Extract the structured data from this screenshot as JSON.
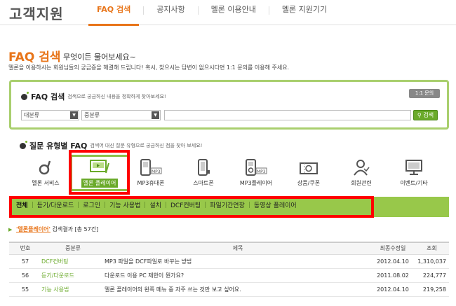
{
  "header": {
    "logo": "고객지원",
    "tabs": [
      {
        "label": "FAQ 검색"
      },
      {
        "label": "공지사항"
      },
      {
        "label": "멜론 이용안내"
      },
      {
        "label": "멜론 지원기기"
      }
    ]
  },
  "page": {
    "title": "FAQ 검색",
    "subtitle": "무엇이든 물어보세요~",
    "description": "멜론을 이용하시는 회원님들의 궁금증을 해결해 드립니다! 혹시, 찾으시는 답변이 없으시다면 1:1 문의를 이용해 주세요."
  },
  "search": {
    "title": "FAQ 검색",
    "hint": "검색으로 궁금하신 내용을 정확하게 찾아보세요!",
    "one_to_one": "1:1 문의",
    "category1": "대분류",
    "category2": "중분류",
    "query": "",
    "button": "검색"
  },
  "question_types": {
    "title": "질문 유형별 FAQ",
    "hint": "검색어 대신 질문 유형으로 궁금하신 점을 찾아 보세요!",
    "categories": [
      {
        "label": "멜론 서비스",
        "icon": "melon-note-icon"
      },
      {
        "label": "멜론 플레이어",
        "icon": "player-icon"
      },
      {
        "label": "MP3휴대폰",
        "icon": "mp3-phone-icon"
      },
      {
        "label": "스마트폰",
        "icon": "smartphone-icon"
      },
      {
        "label": "MP3플레이어",
        "icon": "mp3-player-icon"
      },
      {
        "label": "상품/쿠폰",
        "icon": "coupon-icon"
      },
      {
        "label": "회원관련",
        "icon": "member-icon"
      },
      {
        "label": "이벤트/기타",
        "icon": "event-icon"
      }
    ],
    "selected_index": 1
  },
  "subcategories": [
    "전체",
    "듣기/다운로드",
    "로그인",
    "기능 사용법",
    "설치",
    "DCF컨버팅",
    "파일기간연장",
    "동영상 플레이어"
  ],
  "results": {
    "query": "'멜론플레이어'",
    "summary": "검색결과 [총 57건]"
  },
  "table": {
    "headers": [
      "번호",
      "중분류",
      "제목",
      "최종수정일",
      "조회"
    ],
    "rows": [
      {
        "no": "57",
        "category": "DCF컨버팅",
        "title": "MP3 파일을 DCF파일로 바꾸는 방법",
        "date": "2012.04.10",
        "views": "1,310,037"
      },
      {
        "no": "56",
        "category": "듣기/다운로드",
        "title": "다운로드 이용 PC 제한이 뭔가요?",
        "date": "2011.08.02",
        "views": "224,777"
      },
      {
        "no": "55",
        "category": "기능 사용법",
        "title": "멜론 플레이어의 왼쪽 메뉴 중 자주 쓰는 것만 보고 싶어요.",
        "date": "2012.04.10",
        "views": "219,258"
      }
    ]
  },
  "colors": {
    "accent": "#e8751a",
    "green": "#98c84a",
    "highlight": "#ff0000"
  }
}
